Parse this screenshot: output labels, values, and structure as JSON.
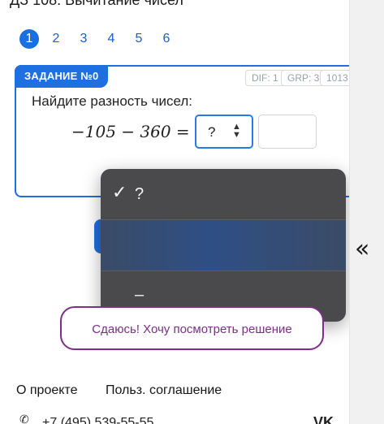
{
  "page": {
    "title": "ДЗ 108. Вычитание чисел"
  },
  "pagination": {
    "pages": [
      "1",
      "2",
      "3",
      "4",
      "5",
      "6"
    ],
    "active": "1"
  },
  "task": {
    "label": "ЗАДАНИЕ №0",
    "meta": {
      "dif": "DIF: 1",
      "grp": "GRP: 3",
      "id": "1013"
    },
    "prompt": "Найдите разность чисел:",
    "formula": "−105 − 360 =",
    "select_value": "?",
    "answer_value": ""
  },
  "dropdown": {
    "options": [
      {
        "text": "?",
        "checked": true
      },
      {
        "text": "",
        "checked": false
      },
      {
        "text": "–",
        "checked": false
      }
    ],
    "check_glyph": "✓"
  },
  "buttons": {
    "submit_label": "",
    "giveup_label": "Сдаюсь! Хочу посмотреть решение"
  },
  "side_panel": {
    "collapse_icon": "«"
  },
  "footer": {
    "about": "О проекте",
    "agreement": "Польз. соглашение",
    "phone": "+7 (495) 539-55-55",
    "social_icon": "vk-icon"
  },
  "colors": {
    "accent": "#1e6fe0",
    "giveup": "#7b2f86",
    "dropdown_bg": "#4a4a4c"
  }
}
